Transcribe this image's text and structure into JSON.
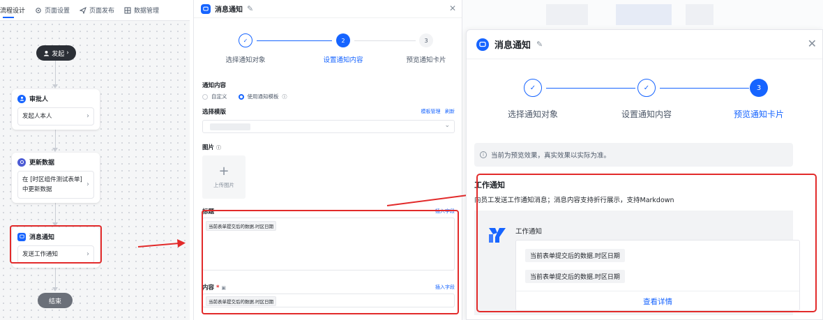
{
  "flow": {
    "nav": [
      {
        "label": "流程设计",
        "icon": ""
      },
      {
        "label": "页面设置",
        "icon": "gear-icon"
      },
      {
        "label": "页面发布",
        "icon": "send-icon"
      },
      {
        "label": "数据管理",
        "icon": "grid-icon"
      }
    ],
    "start_label": "发起",
    "nodes": [
      {
        "title": "审批人",
        "body": "发起人本人",
        "color": "#1664ff"
      },
      {
        "title": "更新数据",
        "body_line1": "在 [时区组件测试表单]",
        "body_line2": "中更新数据",
        "color": "#4c5bd4"
      },
      {
        "title": "消息通知",
        "body": "发送工作通知",
        "color": "#1664ff"
      }
    ],
    "end_label": "结束"
  },
  "middle": {
    "title": "消息通知",
    "steps": [
      {
        "num": "✓",
        "label": "选择通知对象",
        "state": "done"
      },
      {
        "num": "2",
        "label": "设置通知内容",
        "state": "active"
      },
      {
        "num": "3",
        "label": "预览通知卡片",
        "state": "todo"
      }
    ],
    "content_label": "通知内容",
    "radio_custom": "自定义",
    "radio_template": "使用通知模板",
    "template_label": "选择模版",
    "template_manage": "模板管理",
    "template_refresh": "刷新",
    "image_label": "图片",
    "upload_label": "上传图片",
    "title_label": "标题",
    "insert_field": "插入字段",
    "title_tag": "当前表单提交后的数据.时区日期",
    "content_field_label": "内容",
    "content_tag": "当前表单提交后的数据.时区日期"
  },
  "right": {
    "title": "消息通知",
    "steps": [
      {
        "num": "✓",
        "label": "选择通知对象",
        "state": "done"
      },
      {
        "num": "✓",
        "label": "设置通知内容",
        "state": "done"
      },
      {
        "num": "3",
        "label": "预览通知卡片",
        "state": "active"
      }
    ],
    "notice": "当前为预览效果，真实效果以实际为准。",
    "preview_title": "工作通知",
    "preview_desc": "向员工发送工作通知消息；消息内容支持折行展示，支持Markdown",
    "app_name": "工作通知",
    "tag1": "当前表单提交后的数据.时区日期",
    "tag2": "当前表单提交后的数据.时区日期",
    "detail_link": "查看详情"
  },
  "colors": {
    "accent": "#1664ff",
    "highlight": "#e22a2a"
  }
}
